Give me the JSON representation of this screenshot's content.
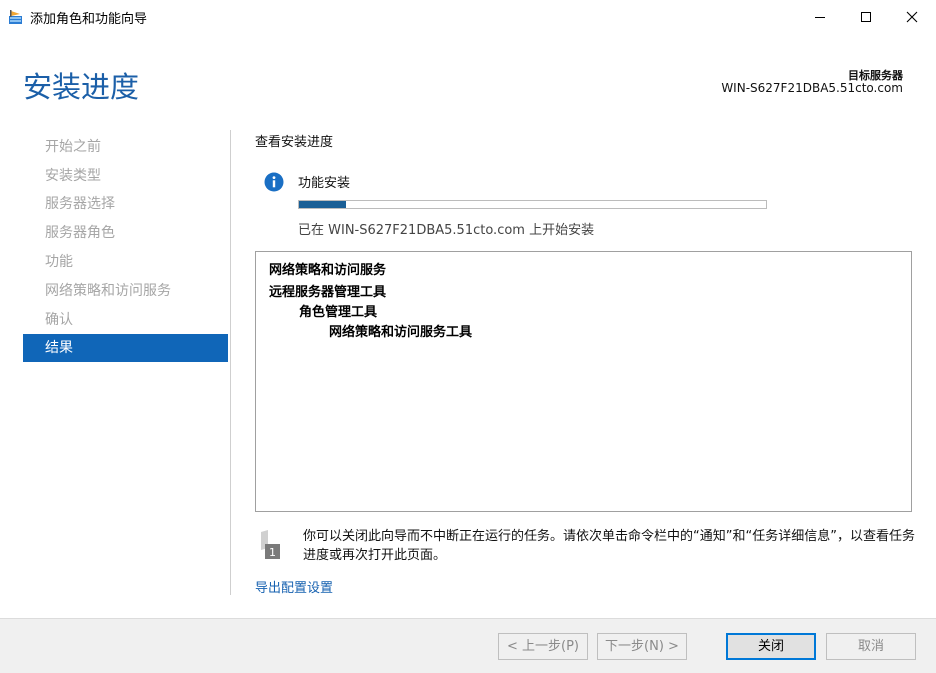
{
  "window": {
    "title": "添加角色和功能向导",
    "minimize_glyph": "—",
    "maximize_glyph": "☐",
    "close_glyph": "✕"
  },
  "header": {
    "page_title": "安装进度",
    "target_label": "目标服务器",
    "target_server": "WIN-S627F21DBA5.51cto.com"
  },
  "sidebar": {
    "items": [
      {
        "label": "开始之前",
        "active": false
      },
      {
        "label": "安装类型",
        "active": false
      },
      {
        "label": "服务器选择",
        "active": false
      },
      {
        "label": "服务器角色",
        "active": false
      },
      {
        "label": "功能",
        "active": false
      },
      {
        "label": "网络策略和访问服务",
        "active": false
      },
      {
        "label": "确认",
        "active": false
      },
      {
        "label": "结果",
        "active": true
      }
    ]
  },
  "main": {
    "section_label": "查看安装进度",
    "feature_label": "功能安装",
    "progress_fraction": 0.1,
    "status_text": "已在 WIN-S627F21DBA5.51cto.com 上开始安装",
    "results": [
      {
        "text": "网络策略和访问服务",
        "level": 0
      },
      {
        "text": "远程服务器管理工具",
        "level": 0
      },
      {
        "text": "角色管理工具",
        "level": 1
      },
      {
        "text": "网络策略和访问服务工具",
        "level": 2
      }
    ],
    "notification_text": "你可以关闭此向导而不中断正在运行的任务。请依次单击命令栏中的“通知”和“任务详细信息”，以查看任务进度或再次打开此页面。",
    "notification_badge": "1",
    "export_link": "导出配置设置"
  },
  "footer": {
    "prev_label": "< 上一步(P)",
    "next_label": "下一步(N) >",
    "close_label": "关闭",
    "cancel_label": "取消"
  },
  "colors": {
    "accent": "#1066b8",
    "title_blue": "#1b5fa8",
    "link_blue": "#1661b0",
    "progress": "#1a5f96"
  }
}
